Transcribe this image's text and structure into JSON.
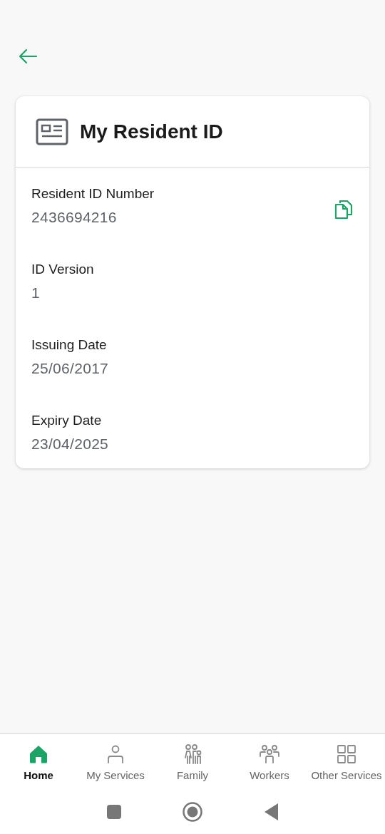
{
  "card": {
    "title": "My Resident ID",
    "fields": [
      {
        "label": "Resident ID Number",
        "value": "2436694216",
        "copyable": true
      },
      {
        "label": "ID Version",
        "value": "1",
        "copyable": false
      },
      {
        "label": "Issuing Date",
        "value": "25/06/2017",
        "copyable": false
      },
      {
        "label": "Expiry Date",
        "value": "23/04/2025",
        "copyable": false
      }
    ]
  },
  "bottom_nav": [
    {
      "kind": "home",
      "label": "Home",
      "selected": true
    },
    {
      "kind": "person",
      "label": "My Services",
      "selected": false
    },
    {
      "kind": "family",
      "label": "Family",
      "selected": false
    },
    {
      "kind": "workers",
      "label": "Workers",
      "selected": false
    },
    {
      "kind": "grid",
      "label": "Other Services",
      "selected": false
    }
  ]
}
